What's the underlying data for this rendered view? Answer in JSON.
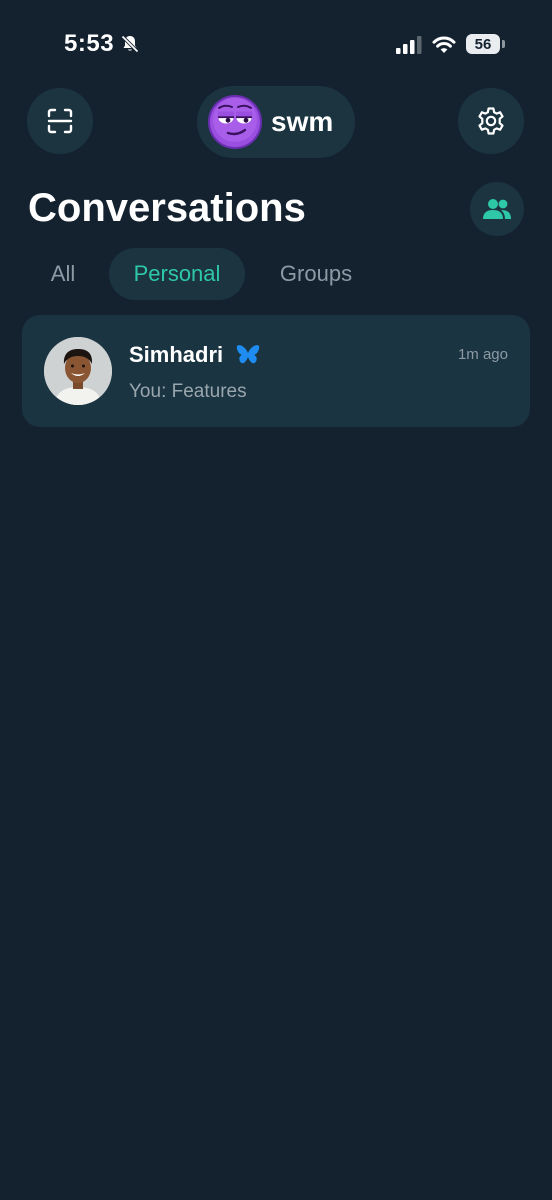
{
  "status_bar": {
    "time": "5:53",
    "battery": "56",
    "icons": [
      "bell-off-icon",
      "signal-icon",
      "wifi-icon",
      "battery-icon"
    ]
  },
  "top_bar": {
    "profile_name": "swm",
    "icons": [
      "scan-icon",
      "emoji-avatar-icon",
      "gear-icon"
    ]
  },
  "header": {
    "title": "Conversations",
    "action_icon": "contacts-icon"
  },
  "tabs": [
    {
      "label": "All",
      "active": false
    },
    {
      "label": "Personal",
      "active": true
    },
    {
      "label": "Groups",
      "active": false
    }
  ],
  "conversations": [
    {
      "name": "Simhadri",
      "badge_icon": "butterfly-icon",
      "time": "1m ago",
      "preview": "You: Features"
    }
  ],
  "colors": {
    "background": "#142230",
    "surface": "#1b3440",
    "accent": "#2ec8a6",
    "badge": "#1e8cf0"
  }
}
